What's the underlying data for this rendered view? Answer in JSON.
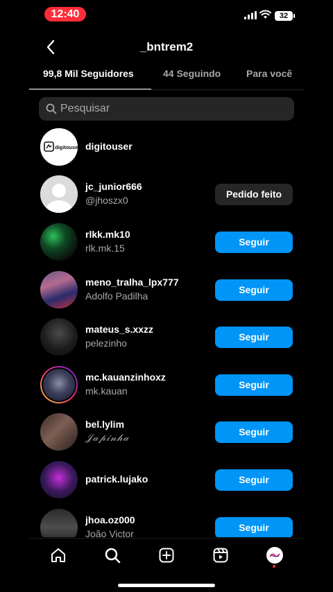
{
  "status": {
    "time": "12:40",
    "battery": "32"
  },
  "header": {
    "title": "_bntrem2"
  },
  "tabs": [
    {
      "label": "99,8 Mil Seguidores"
    },
    {
      "label": "44 Seguindo"
    },
    {
      "label": "Para você"
    }
  ],
  "search": {
    "placeholder": "Pesquisar"
  },
  "avatar_logo_text": "digitouser",
  "users": [
    {
      "username": "digitouser",
      "fullname": "",
      "button": ""
    },
    {
      "username": "jc_junior666",
      "fullname": "@jhoszx0",
      "button": "Pedido feito"
    },
    {
      "username": "rlkk.mk10",
      "fullname": "rlk.mk.15",
      "button": "Seguir"
    },
    {
      "username": "meno_tralha_lpx777",
      "fullname": "Adolfo Padilha",
      "button": "Seguir"
    },
    {
      "username": "mateus_s.xxzz",
      "fullname": "pelezinho",
      "button": "Seguir"
    },
    {
      "username": "mc.kauanzinhoxz",
      "fullname": "mk.kauan",
      "button": "Seguir"
    },
    {
      "username": "bel.lylim",
      "fullname": "𝒥𝒶𝓅𝒾𝓃𝒽𝒶",
      "button": "Seguir"
    },
    {
      "username": "patrick.lujako",
      "fullname": "",
      "button": "Seguir"
    },
    {
      "username": "jhoa.oz000",
      "fullname": "João Victor",
      "button": "Seguir"
    }
  ],
  "colors": {
    "accent": "#0095f6",
    "background": "#000000",
    "secondary_button": "#262626",
    "time_pill": "#ff2d3a"
  }
}
